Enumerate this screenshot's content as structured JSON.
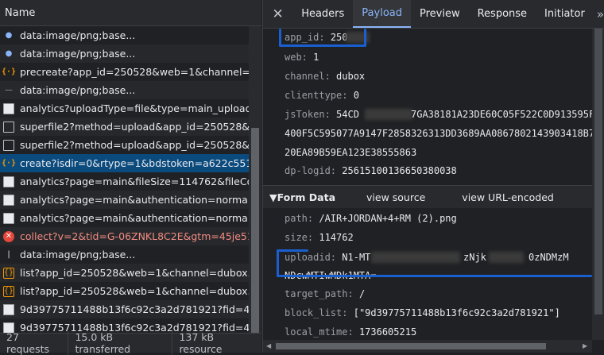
{
  "left": {
    "header": "Name",
    "requests": [
      {
        "icon": "image-icon",
        "name": "data:image/png;base..."
      },
      {
        "icon": "image-icon",
        "name": "data:image/png;base..."
      },
      {
        "icon": "xhr-icon",
        "name": "precreate?app_id=250528&web=1&channel=..."
      },
      {
        "icon": "dash-icon",
        "name": "data:image/png;base..."
      },
      {
        "icon": "document-icon",
        "name": "analytics?uploadType=file&type=main_upload..."
      },
      {
        "icon": "document-outline-icon",
        "name": "superfile2?method=upload&app_id=250528&..."
      },
      {
        "icon": "document-outline-icon",
        "name": "superfile2?method=upload&app_id=250528&..."
      },
      {
        "icon": "xhr-icon",
        "name": "create?isdir=0&rtype=1&bdstoken=a622c551..."
      },
      {
        "icon": "document-icon",
        "name": "analytics?page=main&fileSize=114762&fileCo..."
      },
      {
        "icon": "document-icon",
        "name": "analytics?page=main&authentication=normal..."
      },
      {
        "icon": "document-icon",
        "name": "analytics?page=main&authentication=normal..."
      },
      {
        "icon": "error-icon",
        "name": "collect?v=2&tid=G-06ZNKL8C2E&gtm=45je51..."
      },
      {
        "icon": "bar-icon",
        "name": "data:image/png;base..."
      },
      {
        "icon": "xhr-outline-icon",
        "name": "list?app_id=250528&web=1&channel=dubox..."
      },
      {
        "icon": "xhr-outline-icon",
        "name": "list?app_id=250528&web=1&channel=dubox..."
      },
      {
        "icon": "picture-icon",
        "name": "9d39775711488b13f6c92c3a2d781921?fid=44..."
      },
      {
        "icon": "picture-icon",
        "name": "9d39775711488b13f6c92c3a2d781921?fid=44..."
      }
    ],
    "status": {
      "requests": "27 requests",
      "transferred": "15.0 kB transferred",
      "resources": "137 kB resource"
    }
  },
  "right": {
    "tabs": [
      "Headers",
      "Payload",
      "Preview",
      "Response",
      "Initiator"
    ],
    "active_tab": "Payload",
    "more": "»",
    "close": "✕",
    "query": {
      "app_id": {
        "key": "app_id:",
        "value": "250"
      },
      "web": {
        "key": "web:",
        "value": "1"
      },
      "channel": {
        "key": "channel:",
        "value": "dubox"
      },
      "clienttype": {
        "key": "clienttype:",
        "value": "0"
      },
      "jsToken": {
        "key": "jsToken:",
        "value": "54CD",
        "value_tail": "7GA38181A23DE60C05F522C0D913595FE",
        "line2": "400F5C595077A9147F2858326313DD3689AA0867802143903418B7",
        "line3": "20EA89B59EA123E38555863"
      },
      "dp_logid": {
        "key": "dp-logid:",
        "value": "25615100136650380038"
      }
    },
    "form": {
      "title": "Form Data",
      "view_source": "view source",
      "view_url": "view URL-encoded",
      "path": {
        "key": "path:",
        "value": "/AIR+JORDAN+4+RM (2).png"
      },
      "size": {
        "key": "size:",
        "value": "114762"
      },
      "uploadid": {
        "key": "uploadid:",
        "value": "N1-MT",
        "value_mid": "zNjk",
        "value_tail": "0zNDMzM",
        "line2": "NDcwMTIwMDk1MTA="
      },
      "target_path": {
        "key": "target_path:",
        "value": "/"
      },
      "block_list": {
        "key": "block_list:",
        "value": "[\"9d39775711488b13f6c92c3a2d781921\"]"
      },
      "local_mtime": {
        "key": "local_mtime:",
        "value": "1736605215"
      }
    }
  },
  "colors": {
    "accent": "#8ab4f8",
    "selected_row": "#0b4a7d",
    "annotation": "#1a5fd0",
    "error": "#e4473b"
  }
}
